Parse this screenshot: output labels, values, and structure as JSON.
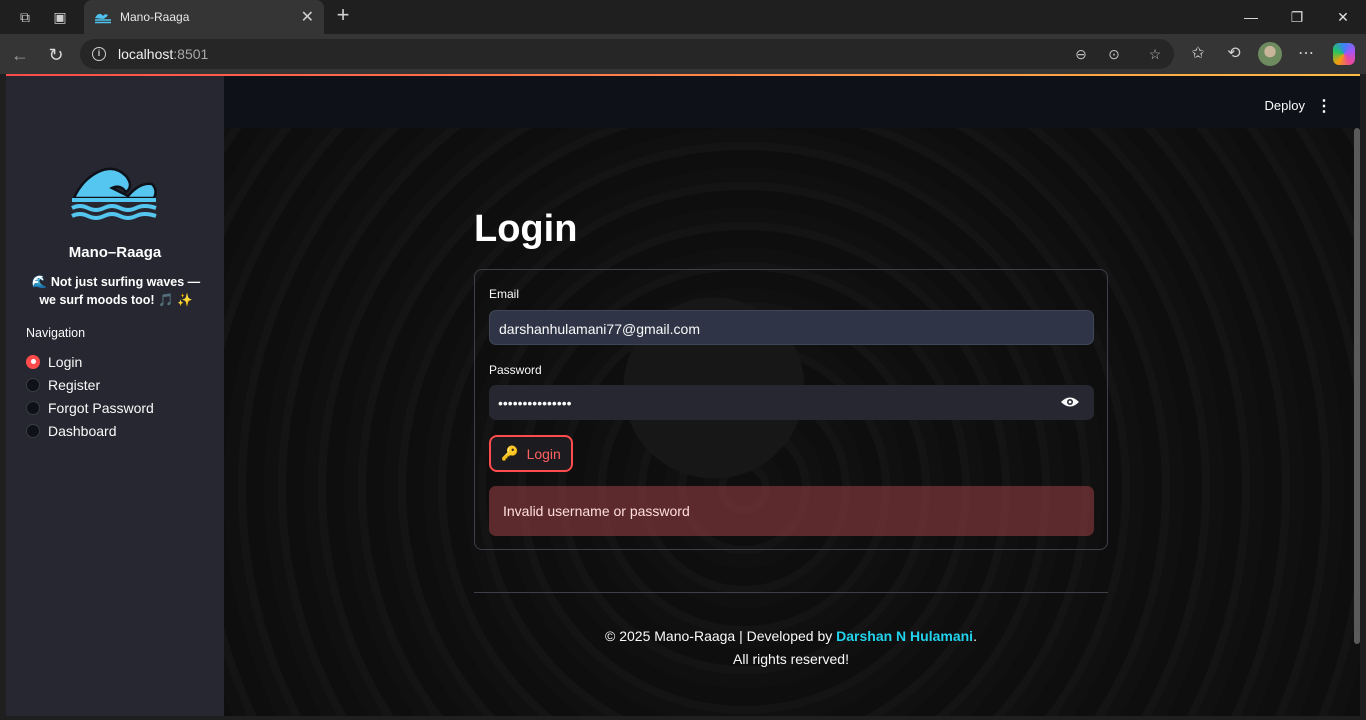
{
  "browser": {
    "tab_title": "Mano-Raaga",
    "url_host": "localhost",
    "url_port": ":8501"
  },
  "app": {
    "header": {
      "deploy_label": "Deploy",
      "menu_icon": "⋮"
    },
    "sidebar": {
      "brand": "Mano–Raaga",
      "tagline": "🌊 Not just surfing waves — we surf moods too! 🎵 ✨",
      "navigation_label": "Navigation",
      "nav_items": [
        {
          "label": "Login",
          "selected": true
        },
        {
          "label": "Register",
          "selected": false
        },
        {
          "label": "Forgot Password",
          "selected": false
        },
        {
          "label": "Dashboard",
          "selected": false
        }
      ]
    },
    "login": {
      "title": "Login",
      "email_label": "Email",
      "email_value": "darshanhulamani77@gmail.com",
      "password_label": "Password",
      "password_value": "•••••••••••••••",
      "button_icon": "🔑",
      "button_label": "Login",
      "error_message": "Invalid username or password"
    },
    "footer": {
      "line1_prefix": "© 2025 Mano-Raaga | Developed by ",
      "author": "Darshan N Hulamani",
      "line1_suffix": ".",
      "line2": "All rights reserved!"
    },
    "colors": {
      "accent": "#ff4b4b",
      "author_link": "#22d3ee",
      "error_bg": "#7d353b"
    }
  }
}
